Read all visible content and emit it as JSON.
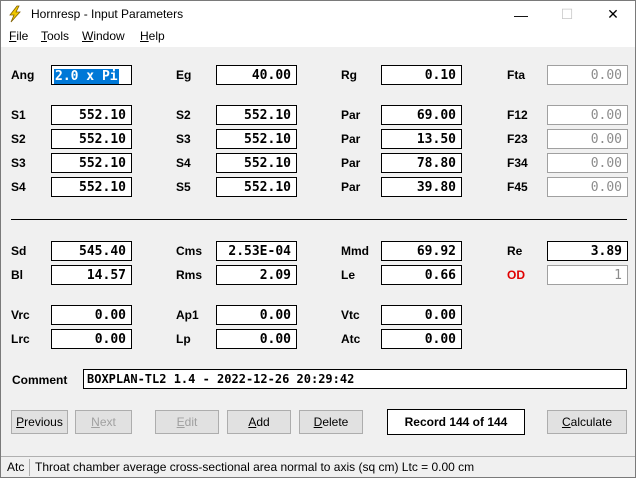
{
  "window": {
    "title": "Hornresp - Input Parameters",
    "controls": {
      "minimize": "—",
      "maximize": "☐",
      "close": "✕"
    }
  },
  "menu": [
    "File",
    "Tools",
    "Window",
    "Help"
  ],
  "fields": {
    "ang": {
      "label": "Ang",
      "value": "2.0 x Pi"
    },
    "eg": {
      "label": "Eg",
      "value": "40.00"
    },
    "rg": {
      "label": "Rg",
      "value": "0.10"
    },
    "fta": {
      "label": "Fta",
      "value": "0.00"
    },
    "s1": {
      "label": "S1",
      "value": "552.10"
    },
    "s2": {
      "label": "S2",
      "value": "552.10"
    },
    "s2b": {
      "label": "S2",
      "value": "552.10"
    },
    "s3": {
      "label": "S3",
      "value": "552.10"
    },
    "s3b": {
      "label": "S3",
      "value": "552.10"
    },
    "s4": {
      "label": "S4",
      "value": "552.10"
    },
    "s4b": {
      "label": "S4",
      "value": "552.10"
    },
    "s5": {
      "label": "S5",
      "value": "552.10"
    },
    "par1": {
      "label": "Par",
      "value": "69.00"
    },
    "par2": {
      "label": "Par",
      "value": "13.50"
    },
    "par3": {
      "label": "Par",
      "value": "78.80"
    },
    "par4": {
      "label": "Par",
      "value": "39.80"
    },
    "f12": {
      "label": "F12",
      "value": "0.00"
    },
    "f23": {
      "label": "F23",
      "value": "0.00"
    },
    "f34": {
      "label": "F34",
      "value": "0.00"
    },
    "f45": {
      "label": "F45",
      "value": "0.00"
    },
    "sd": {
      "label": "Sd",
      "value": "545.40"
    },
    "cms": {
      "label": "Cms",
      "value": "2.53E-04"
    },
    "mmd": {
      "label": "Mmd",
      "value": "69.92"
    },
    "re": {
      "label": "Re",
      "value": "3.89"
    },
    "bl": {
      "label": "Bl",
      "value": "14.57"
    },
    "rms": {
      "label": "Rms",
      "value": "2.09"
    },
    "le": {
      "label": "Le",
      "value": "0.66"
    },
    "od": {
      "label": "OD",
      "value": "1"
    },
    "vrc": {
      "label": "Vrc",
      "value": "0.00"
    },
    "ap1": {
      "label": "Ap1",
      "value": "0.00"
    },
    "vtc": {
      "label": "Vtc",
      "value": "0.00"
    },
    "lrc": {
      "label": "Lrc",
      "value": "0.00"
    },
    "lp": {
      "label": "Lp",
      "value": "0.00"
    },
    "atc": {
      "label": "Atc",
      "value": "0.00"
    }
  },
  "comment": {
    "label": "Comment",
    "value": "BOXPLAN-TL2 1.4 - 2022-12-26 20:29:42"
  },
  "buttons": {
    "previous": "Previous",
    "next": "Next",
    "edit": "Edit",
    "add": "Add",
    "delete": "Delete",
    "calculate": "Calculate"
  },
  "record": "Record 144 of 144",
  "status": {
    "field": "Atc",
    "description": "Throat chamber average cross-sectional area normal to axis  (sq cm)   Ltc = 0.00 cm"
  },
  "colors": {
    "selection": "#0078d7",
    "od_label": "#e00000",
    "icon": "#f0c800"
  }
}
